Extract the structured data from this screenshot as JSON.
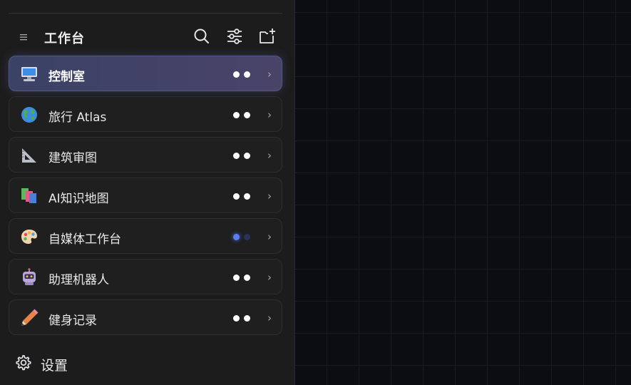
{
  "header": {
    "title": "工作台",
    "icons": [
      "menu-icon",
      "search-icon",
      "filter-icon",
      "add-folder-icon"
    ]
  },
  "items": [
    {
      "label": "控制室",
      "icon": "monitor-icon",
      "status": "idle",
      "active": true
    },
    {
      "label": "旅行 Atlas",
      "icon": "globe-icon",
      "status": "idle",
      "active": false
    },
    {
      "label": "建筑审图",
      "icon": "set-square-icon",
      "status": "idle",
      "active": false
    },
    {
      "label": "AI知识地图",
      "icon": "books-icon",
      "status": "idle",
      "active": false
    },
    {
      "label": "自媒体工作台",
      "icon": "palette-icon",
      "status": "loading",
      "active": false
    },
    {
      "label": "助理机器人",
      "icon": "robot-icon",
      "status": "idle",
      "active": false
    },
    {
      "label": "健身记录",
      "icon": "pencil-icon",
      "status": "idle",
      "active": false
    }
  ],
  "settings": {
    "label": "设置",
    "icon": "gear-icon"
  },
  "colors": {
    "sidebar_bg": "#1c1c1c",
    "canvas_bg": "#0b0d12",
    "active_item": "#3a4266",
    "status_loading": "#5b7df2"
  }
}
